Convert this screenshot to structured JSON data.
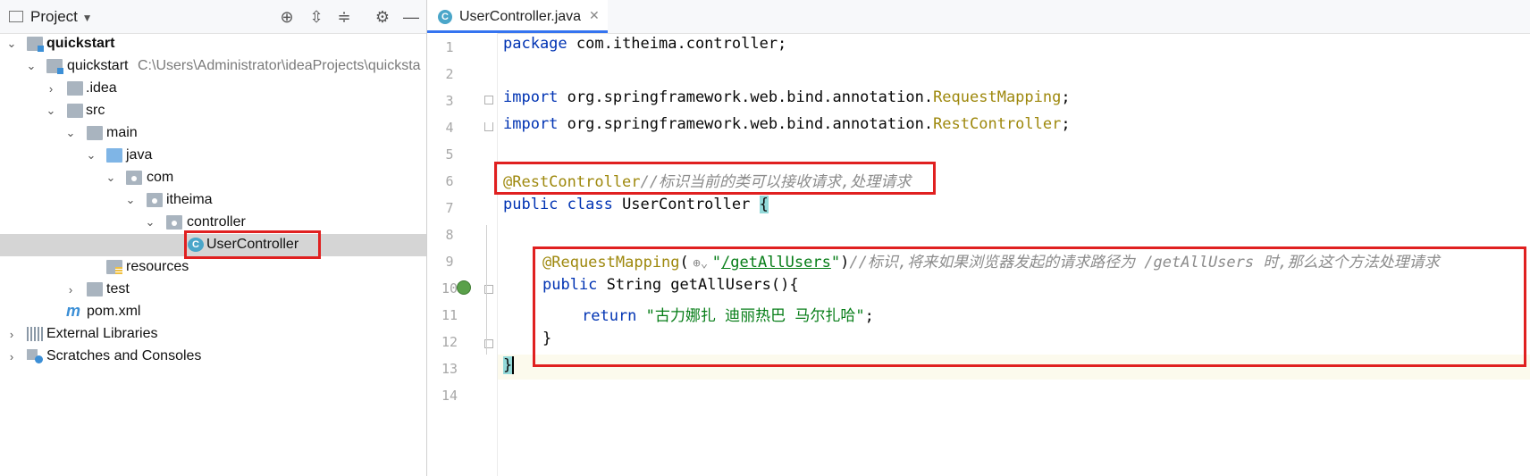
{
  "project_panel": {
    "title": "Project",
    "tree": [
      {
        "label": "quickstart",
        "bold": true
      },
      {
        "label": "quickstart",
        "path": "C:\\Users\\Administrator\\ideaProjects\\quicksta"
      },
      {
        "label": ".idea"
      },
      {
        "label": "src"
      },
      {
        "label": "main"
      },
      {
        "label": "java"
      },
      {
        "label": "com"
      },
      {
        "label": "itheima"
      },
      {
        "label": "controller"
      },
      {
        "label": "UserController"
      },
      {
        "label": "resources"
      },
      {
        "label": "test"
      },
      {
        "label": "pom.xml"
      },
      {
        "label": "External Libraries"
      },
      {
        "label": "Scratches and Consoles"
      }
    ]
  },
  "editor": {
    "tab_label": "UserController.java",
    "line_numbers": [
      "1",
      "2",
      "3",
      "4",
      "5",
      "6",
      "7",
      "8",
      "9",
      "10",
      "11",
      "12",
      "13",
      "14"
    ],
    "code": {
      "l1_kw": "package",
      "l1_rest": " com.itheima.controller;",
      "l3_kw": "import",
      "l3_rest": " org.springframework.web.bind.annotation.",
      "l3_ann": "RequestMapping",
      "l3_end": ";",
      "l4_kw": "import",
      "l4_rest": " org.springframework.web.bind.annotation.",
      "l4_ann": "RestController",
      "l4_end": ";",
      "l6_ann": "@RestController",
      "l6_cmt": "//标识当前的类可以接收请求,处理请求",
      "l7_kw": "public class",
      "l7_rest": " UserController ",
      "l7_brace": "{",
      "l9_ann": "@RequestMapping",
      "l9_open": "(",
      "l9_q1": "\"",
      "l9_path": "/getAllUsers",
      "l9_q2": "\"",
      "l9_close": ")",
      "l9_cmt": "//标识,将来如果浏览器发起的请求路径为 /getAllUsers 时,那么这个方法处理请求",
      "l10_kw": "public",
      "l10_rest": " String getAllUsers(){",
      "l11_kw": "return",
      "l11_str": "\"古力娜扎 迪丽热巴 马尔扎哈\"",
      "l11_end": ";",
      "l12": "}",
      "l13": "}"
    }
  },
  "colors": {
    "keyword": "#0033b3",
    "annotation": "#9e880d",
    "comment": "#8c8c8c",
    "string": "#067d17",
    "highlight_box": "#e02020"
  }
}
